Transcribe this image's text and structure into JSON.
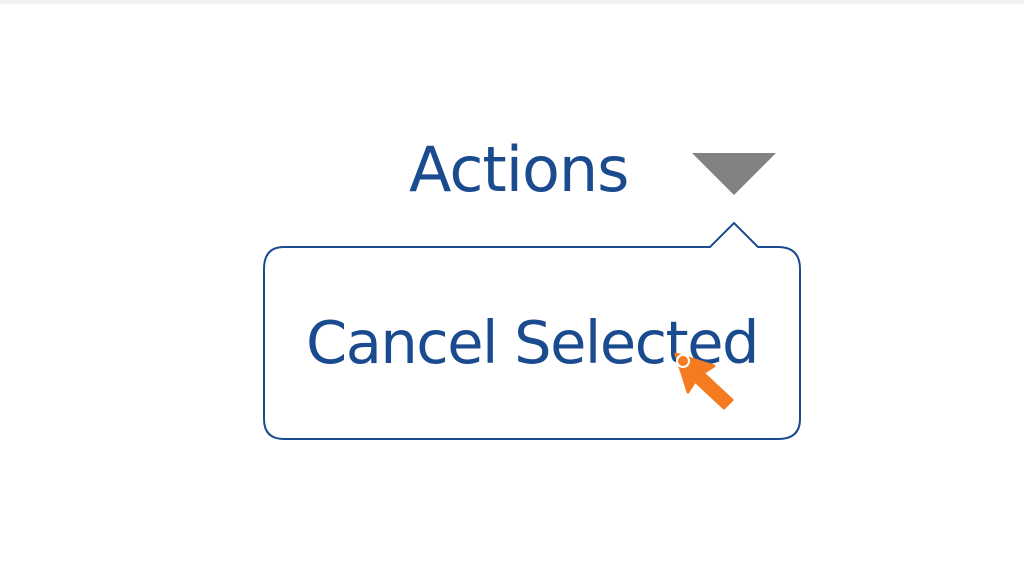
{
  "actions_menu": {
    "label": "Actions",
    "toggle_icon": "caret-down-icon",
    "items": [
      {
        "label": "Cancel Selected"
      }
    ]
  },
  "cursor": {
    "icon": "mouse-pointer-icon",
    "color": "#f47b20"
  },
  "colors": {
    "text": "#1b4b8f",
    "caret": "#808284",
    "popover_border": "#1b4b8f"
  }
}
